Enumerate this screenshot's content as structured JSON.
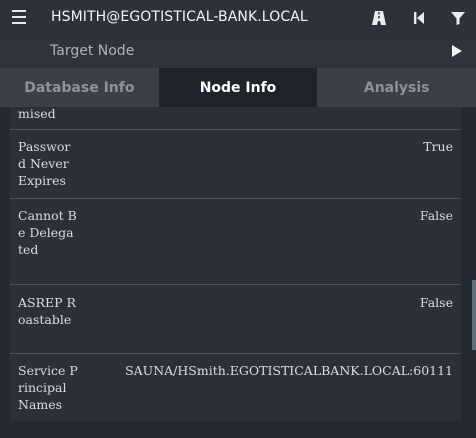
{
  "header": {
    "node_title": "HSMITH@EGOTISTICAL-BANK.LOCAL",
    "icons": [
      "menu-icon",
      "pathfinding-icon",
      "back-icon",
      "filter-icon"
    ]
  },
  "search": {
    "placeholder": "Target Node",
    "play_icon": "play-icon"
  },
  "tabs": [
    {
      "label": "Database Info",
      "active": false
    },
    {
      "label": "Node Info",
      "active": true
    },
    {
      "label": "Analysis",
      "active": false
    }
  ],
  "properties": [
    {
      "label": "mised",
      "value": ""
    },
    {
      "label": "Password Never Expires",
      "value": "True"
    },
    {
      "label": "Cannot Be Delegated",
      "value": "False"
    },
    {
      "label": "ASREP Roastable",
      "value": "False"
    },
    {
      "label": "Service Principal Names",
      "value": "SAUNA/HSmith.EGOTISTICALBANK.LOCAL:60111"
    }
  ],
  "colors": {
    "topbar": "#2d323a",
    "active_tab": "#1f232a",
    "inactive_tab": "#3b4048",
    "panel": "#2c3139"
  }
}
